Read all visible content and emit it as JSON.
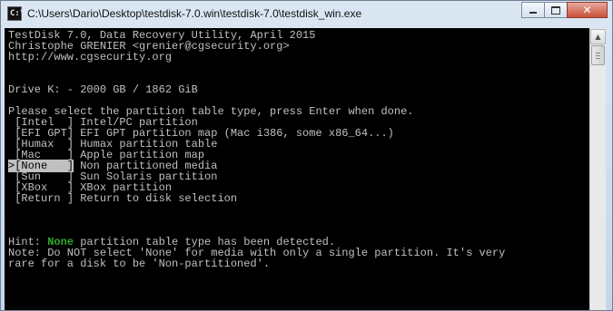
{
  "window": {
    "title": "C:\\Users\\Dario\\Desktop\\testdisk-7.0.win\\testdisk-7.0\\testdisk_win.exe",
    "icon_label": "C:\\",
    "controls": {
      "minimize": "minimize-icon",
      "maximize": "maximize-icon",
      "close": "✕"
    }
  },
  "console": {
    "header": [
      "TestDisk 7.0, Data Recovery Utility, April 2015",
      "Christophe GRENIER <grenier@cgsecurity.org>",
      "http://www.cgsecurity.org"
    ],
    "drive_line": "Drive K: - 2000 GB / 1862 GiB",
    "prompt": "Please select the partition table type, press Enter when done.",
    "options": [
      {
        "prefix": " ",
        "key": "[Intel  ]",
        "desc": " Intel/PC partition"
      },
      {
        "prefix": " ",
        "key": "[EFI GPT]",
        "desc": " EFI GPT partition map (Mac i386, some x86_64...)"
      },
      {
        "prefix": " ",
        "key": "[Humax  ]",
        "desc": " Humax partition table"
      },
      {
        "prefix": " ",
        "key": "[Mac    ]",
        "desc": " Apple partition map"
      },
      {
        "prefix": ">",
        "key": "[None   ]",
        "desc": " Non partitioned media"
      },
      {
        "prefix": " ",
        "key": "[Sun    ]",
        "desc": " Sun Solaris partition"
      },
      {
        "prefix": " ",
        "key": "[XBox   ]",
        "desc": " XBox partition"
      },
      {
        "prefix": " ",
        "key": "[Return ]",
        "desc": " Return to disk selection"
      }
    ],
    "selected_option": "None",
    "hint": {
      "label": "Hint: ",
      "highlight": "None",
      "text": " partition table type has been detected."
    },
    "note": [
      "Note: Do NOT select 'None' for media with only a single partition. It's very",
      "rare for a disk to be 'Non-partitioned'."
    ],
    "highlight_color": "#31a82f",
    "text_color": "#c0c0c0",
    "background_color": "#000000"
  },
  "scrollbar": {
    "up_icon": "▲"
  }
}
